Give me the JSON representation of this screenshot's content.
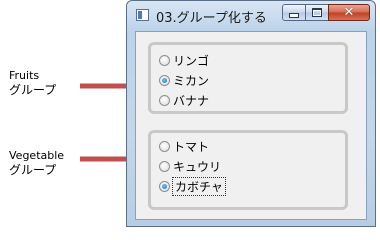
{
  "annotations": {
    "fruits": {
      "title": "Fruits",
      "subtitle": "グループ"
    },
    "vegetable": {
      "title": "Vegetable",
      "subtitle": "グループ"
    },
    "arrow_color": "#c0504d"
  },
  "window": {
    "title": "03.グループ化する",
    "icons": {
      "minimize": "minimize-icon",
      "maximize": "maximize-icon",
      "close": "close-icon"
    },
    "close_glyph": "✕"
  },
  "groups": {
    "fruits": {
      "options": [
        {
          "label": "リンゴ",
          "checked": false
        },
        {
          "label": "ミカン",
          "checked": true
        },
        {
          "label": "バナナ",
          "checked": false
        }
      ]
    },
    "vegetable": {
      "options": [
        {
          "label": "トマト",
          "checked": false
        },
        {
          "label": "キュウリ",
          "checked": false
        },
        {
          "label": "カボチャ",
          "checked": true,
          "focused": true
        }
      ]
    }
  }
}
